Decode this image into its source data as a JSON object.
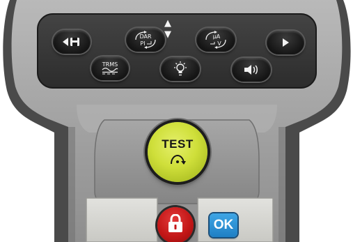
{
  "device": {
    "body_color": "#9c9c9c",
    "keypad_color": "#3a3a3a",
    "accent_yellow": "#cfdf3a",
    "accent_red": "#c31717",
    "accent_blue": "#2a8fd4"
  },
  "keypad": {
    "nav_arrows": "▲ ▼",
    "keys": [
      {
        "id": "save",
        "icon": "left-arrow-save-icon"
      },
      {
        "id": "dar-pi",
        "top": "DAR",
        "bottom": "PI",
        "icon": "dar-pi-icon"
      },
      {
        "id": "ua-v",
        "top": "μA",
        "bottom": "V",
        "icon": "ua-v-icon"
      },
      {
        "id": "next",
        "icon": "right-arrow-icon"
      },
      {
        "id": "trms",
        "label": "TRMS",
        "icon": "ac-dc-icon"
      },
      {
        "id": "backlight",
        "icon": "lightbulb-icon"
      },
      {
        "id": "sound",
        "icon": "speaker-icon"
      }
    ]
  },
  "test_button": {
    "label": "TEST",
    "icon": "rotate-arrow-icon"
  },
  "lock_button": {
    "icon": "padlock-icon"
  },
  "ok_button": {
    "label": "OK"
  }
}
